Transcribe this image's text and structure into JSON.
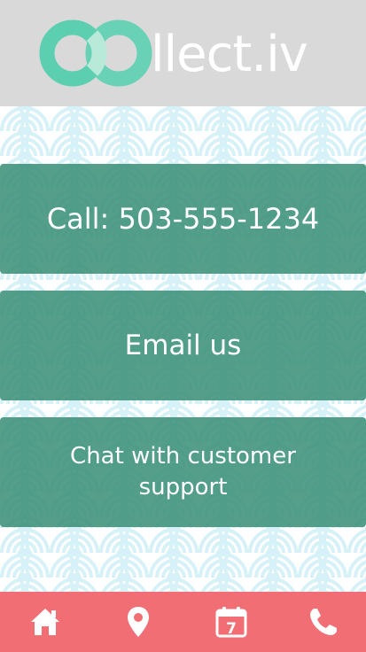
{
  "app": {
    "logo_text": "llect.iv"
  },
  "buttons": {
    "call_label": "Call: 503-555-1234",
    "email_label": "Email us",
    "chat_label": "Chat with customer support"
  },
  "tabbar": {
    "items": [
      {
        "icon": "home-icon"
      },
      {
        "icon": "location-pin-icon"
      },
      {
        "icon": "calendar-icon",
        "badge": "7"
      },
      {
        "icon": "phone-icon"
      }
    ]
  },
  "colors": {
    "header_bg": "#d9d9d9",
    "logo_accent": "#5ccfb0",
    "button_bg": "#3d917a",
    "pattern": "#d6f1f7",
    "tabbar_bg": "#f06e74"
  }
}
